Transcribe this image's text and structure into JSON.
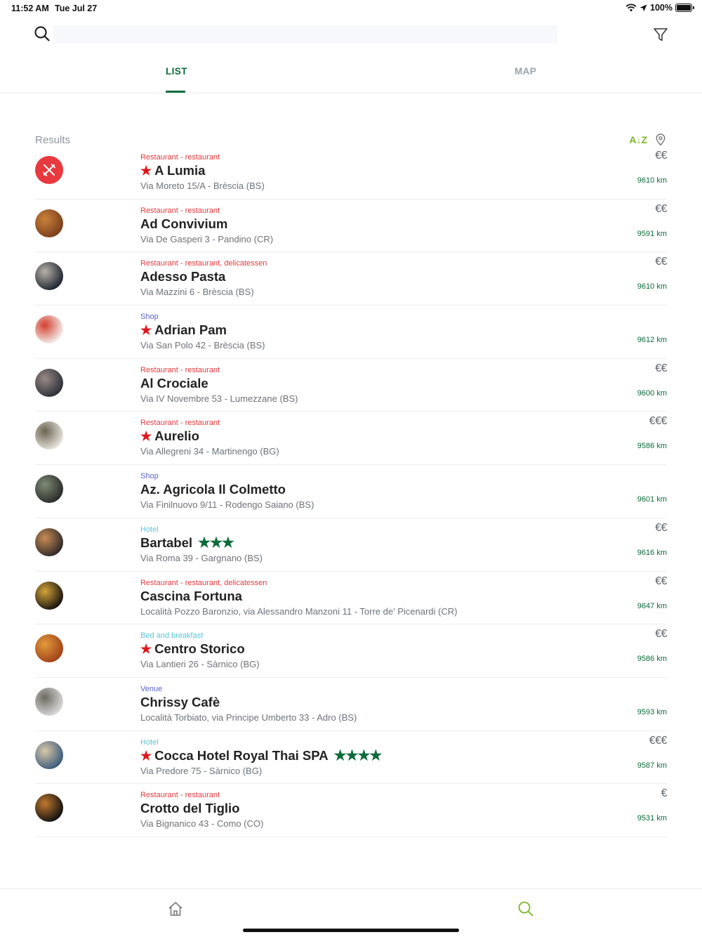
{
  "status_bar": {
    "time": "11:52 AM",
    "date": "Tue Jul 27",
    "battery": "100%"
  },
  "search": {
    "placeholder": "",
    "value": ""
  },
  "tabs": [
    {
      "label": "LIST",
      "active": true
    },
    {
      "label": "MAP",
      "active": false
    }
  ],
  "results": {
    "label": "Results",
    "sort_label": "A↓Z",
    "items": [
      {
        "category": "Restaurant - restaurant",
        "name": "A Lumia",
        "featured": true,
        "hotel_stars": 0,
        "address": "Via Moreto 15/A - Brèscia (BS)",
        "price": "€€",
        "distance": "9610 km"
      },
      {
        "category": "Restaurant - restaurant",
        "name": "Ad Convivium",
        "featured": false,
        "hotel_stars": 0,
        "address": "Via De Gasperi 3 - Pandino (CR)",
        "price": "€€",
        "distance": "9591 km"
      },
      {
        "category": "Restaurant - restaurant, delicatessen",
        "name": "Adesso Pasta",
        "featured": false,
        "hotel_stars": 0,
        "address": "Via Mazzini 6 - Brèscia (BS)",
        "price": "€€",
        "distance": "9610 km"
      },
      {
        "category": "Shop",
        "name": "Adrian Pam",
        "featured": true,
        "hotel_stars": 0,
        "address": "Via San Polo 42 - Brèscia (BS)",
        "price": "",
        "distance": "9612 km"
      },
      {
        "category": "Restaurant - restaurant",
        "name": "Al Crociale",
        "featured": false,
        "hotel_stars": 0,
        "address": "Via IV Novembre 53 - Lumezzane (BS)",
        "price": "€€",
        "distance": "9600 km"
      },
      {
        "category": "Restaurant - restaurant",
        "name": "Aurelio",
        "featured": true,
        "hotel_stars": 0,
        "address": "Via Allegreni 34 - Martinengo (BG)",
        "price": "€€€",
        "distance": "9586 km"
      },
      {
        "category": "Shop",
        "name": "Az. Agricola Il Colmetto",
        "featured": false,
        "hotel_stars": 0,
        "address": "Via Finilnuovo 9/11 - Rodengo Saiano (BS)",
        "price": "",
        "distance": "9601 km"
      },
      {
        "category": "Hotel",
        "name": "Bartabel",
        "featured": false,
        "hotel_stars": 3,
        "address": "Via Roma 39 - Gargnano (BS)",
        "price": "€€",
        "distance": "9616 km"
      },
      {
        "category": "Restaurant - restaurant, delicatessen",
        "name": "Cascina Fortuna",
        "featured": false,
        "hotel_stars": 0,
        "address": "Località Pozzo Baronzio, via Alessandro Manzoni 11 - Torre de' Picenardi (CR)",
        "price": "€€",
        "distance": "9647 km"
      },
      {
        "category": "Bed and breakfast",
        "name": "Centro Storico",
        "featured": true,
        "hotel_stars": 0,
        "address": "Via Lantieri 26 - Sàrnico (BG)",
        "price": "€€",
        "distance": "9586 km"
      },
      {
        "category": "Venue",
        "name": "Chrissy Cafè",
        "featured": false,
        "hotel_stars": 0,
        "address": "Località Torbiato, via Principe Umberto 33 - Adro (BS)",
        "price": "",
        "distance": "9593 km"
      },
      {
        "category": "Hotel",
        "name": "Cocca Hotel Royal Thai SPA",
        "featured": true,
        "hotel_stars": 4,
        "address": "Via Predore 75 - Sàrnico (BG)",
        "price": "€€€",
        "distance": "9587 km"
      },
      {
        "category": "Restaurant - restaurant",
        "name": "Crotto del Tiglio",
        "featured": false,
        "hotel_stars": 0,
        "address": "Via Bignanico 43 - Como (CO)",
        "price": "€",
        "distance": "9531 km"
      }
    ]
  },
  "bottom_nav": [
    {
      "icon": "home-icon",
      "active": false
    },
    {
      "icon": "search-icon",
      "active": true
    }
  ],
  "colors": {
    "accent_green": "#0d6b3a",
    "sort_green": "#7ab72a",
    "restaurant_red": "#e8393f",
    "shop_purple": "#5a63c9",
    "hotel_cyan": "#56c7d8",
    "featured_star_red": "#e0161d"
  }
}
